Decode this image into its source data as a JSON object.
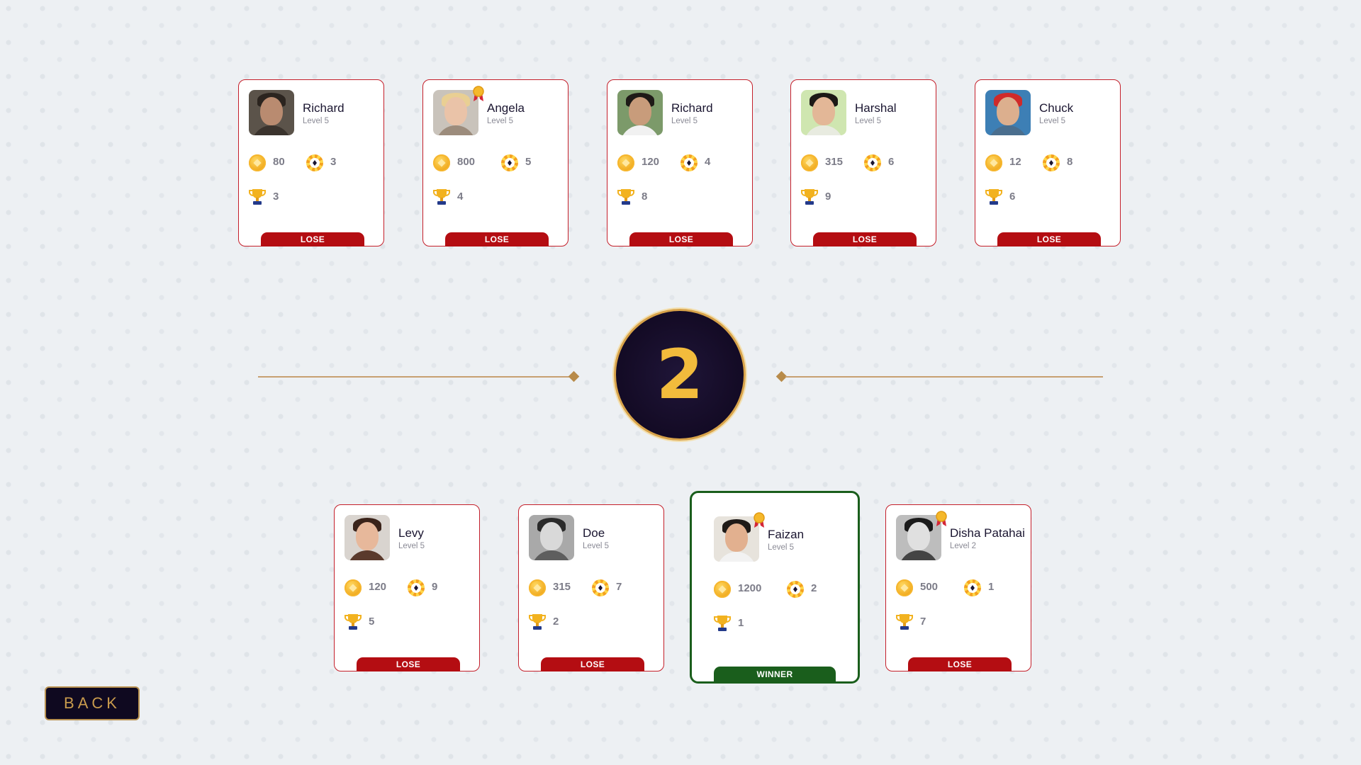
{
  "round": {
    "number": "2"
  },
  "back_label": "BACK",
  "players_top": [
    {
      "name": "Richard",
      "level": "Level 5",
      "coins": "80",
      "chips": "3",
      "trophies": "3",
      "result": "LOSE",
      "medal": false
    },
    {
      "name": "Angela",
      "level": "Level 5",
      "coins": "800",
      "chips": "5",
      "trophies": "4",
      "result": "LOSE",
      "medal": true
    },
    {
      "name": "Richard",
      "level": "Level 5",
      "coins": "120",
      "chips": "4",
      "trophies": "8",
      "result": "LOSE",
      "medal": false
    },
    {
      "name": "Harshal",
      "level": "Level 5",
      "coins": "315",
      "chips": "6",
      "trophies": "9",
      "result": "LOSE",
      "medal": false
    },
    {
      "name": "Chuck",
      "level": "Level 5",
      "coins": "12",
      "chips": "8",
      "trophies": "6",
      "result": "LOSE",
      "medal": false
    }
  ],
  "players_bottom": [
    {
      "name": "Levy",
      "level": "Level 5",
      "coins": "120",
      "chips": "9",
      "trophies": "5",
      "result": "LOSE",
      "medal": false
    },
    {
      "name": "Doe",
      "level": "Level 5",
      "coins": "315",
      "chips": "7",
      "trophies": "2",
      "result": "LOSE",
      "medal": false
    },
    {
      "name": "Faizan",
      "level": "Level 5",
      "coins": "1200",
      "chips": "2",
      "trophies": "1",
      "result": "WINNER",
      "medal": true
    },
    {
      "name": "Disha Patahai",
      "level": "Level 2",
      "coins": "500",
      "chips": "1",
      "trophies": "7",
      "result": "LOSE",
      "medal": true
    }
  ],
  "colors": {
    "lose": "#b40d12",
    "winner": "#1a5e1c",
    "round_bg": "#150c27",
    "round_digit": "#f2bb3c",
    "gold_accent": "#c99b4d"
  }
}
